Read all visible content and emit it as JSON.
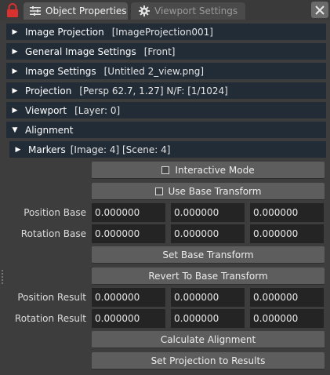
{
  "tabs": {
    "object_properties": "Object Properties",
    "viewport_settings": "Viewport Settings"
  },
  "sections": [
    {
      "title": "Image Projection",
      "value": "[ImageProjection001]",
      "expanded": false
    },
    {
      "title": "General Image Settings",
      "value": "[Front]",
      "expanded": false
    },
    {
      "title": "Image Settings",
      "value": "[Untitled 2_view.png]",
      "expanded": false
    },
    {
      "title": "Projection",
      "value": "[Persp 62.7, 1.27] N/F: [1/1024]",
      "expanded": false
    },
    {
      "title": "Viewport",
      "value": "[Layer: 0]",
      "expanded": false
    },
    {
      "title": "Alignment",
      "value": "",
      "expanded": true
    }
  ],
  "markers": {
    "title": "Markers",
    "value": "[Image: 4] [Scene: 4]",
    "expanded": false
  },
  "alignment": {
    "interactive_mode": {
      "label": "Interactive Mode",
      "checked": false
    },
    "use_base_transform": {
      "label": "Use Base Transform",
      "checked": false
    },
    "position_base": {
      "label": "Position Base",
      "values": [
        "0.000000",
        "0.000000",
        "0.000000"
      ]
    },
    "rotation_base": {
      "label": "Rotation Base",
      "values": [
        "0.000000",
        "0.000000",
        "0.000000"
      ]
    },
    "set_base_transform": "Set Base Transform",
    "revert_to_base_transform": "Revert To Base Transform",
    "position_result": {
      "label": "Position Result",
      "values": [
        "0.000000",
        "0.000000",
        "0.000000"
      ]
    },
    "rotation_result": {
      "label": "Rotation Result",
      "values": [
        "0.000000",
        "0.000000",
        "0.000000"
      ]
    },
    "calculate_alignment": "Calculate Alignment",
    "set_projection_to_results": "Set Projection to Results"
  },
  "colors": {
    "section_header": "#222c37",
    "field_bg": "#242424",
    "button_bg": "#5d5d5d",
    "lock_red": "#d93030"
  }
}
